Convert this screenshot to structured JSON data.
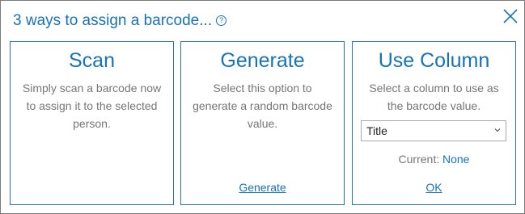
{
  "dialog": {
    "title": "3 ways to assign a barcode...",
    "help_icon": "help-circle-icon",
    "close_icon": "close-icon"
  },
  "panels": {
    "scan": {
      "title": "Scan",
      "description": "Simply scan a barcode now to assign it to the selected person."
    },
    "generate": {
      "title": "Generate",
      "description": "Select this option to generate a random barcode value.",
      "link": "Generate"
    },
    "use_column": {
      "title": "Use Column",
      "description": "Select a column to use as the barcode value.",
      "select_value": "Title",
      "current_label": "Current:",
      "current_value": "None",
      "link": "OK"
    }
  },
  "colors": {
    "accent": "#1773b8",
    "panel_border": "#2a6fb3",
    "muted_text": "#767676"
  }
}
